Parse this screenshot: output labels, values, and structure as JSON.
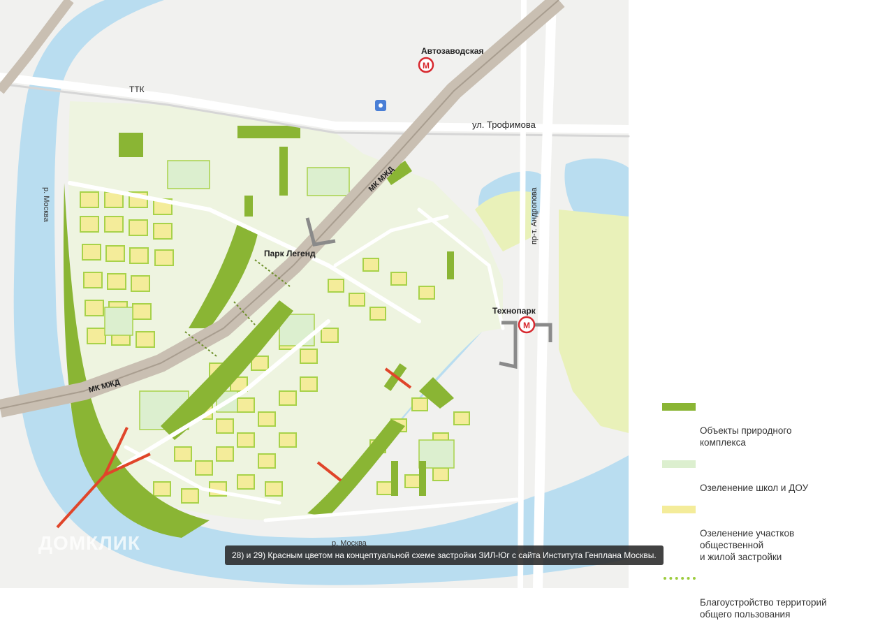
{
  "map": {
    "labels": {
      "ttk": "ТТК",
      "trofimova": "ул. Трофимова",
      "avtozavodskaya": "Автозаводская",
      "mkzhd_top": "МК МЖД",
      "mkzhd_bottom": "МК МЖД",
      "andropova": "пр-т. Андропова",
      "park_legend": "Парк Легенд",
      "tekhnopark": "Технопарк",
      "moskva_river_left": "р. Москва",
      "moskva_river_bottom": "р. Москва",
      "metro_symbol": "М"
    },
    "watermark": "ДОМКЛИК",
    "colors": {
      "water": "#b9ddf0",
      "nature": "#8ab534",
      "school_green": "#dcefcf",
      "residential_yellow": "#f4ec9a",
      "red_bridge": "#e0452a",
      "railway": "#c9bfb2",
      "metro_red": "#d7282e"
    }
  },
  "legend": {
    "items": [
      {
        "label": "Объекты природного\nкомплекса",
        "color": "#8ab534"
      },
      {
        "label": "Озеленение школ и ДОУ",
        "color": "#dcefcf"
      },
      {
        "label": "Озеленение участков\nобщественной\nи жилой застройки",
        "color": "#f4ec9a"
      },
      {
        "label": "Благоустройство территорий\nобщего пользования",
        "color": "#9ccc3c"
      }
    ]
  },
  "caption": "28) и 29) Красным цветом на концептуальной схеме застройки ЗИЛ-Юг с сайта Института Генплана Москвы."
}
